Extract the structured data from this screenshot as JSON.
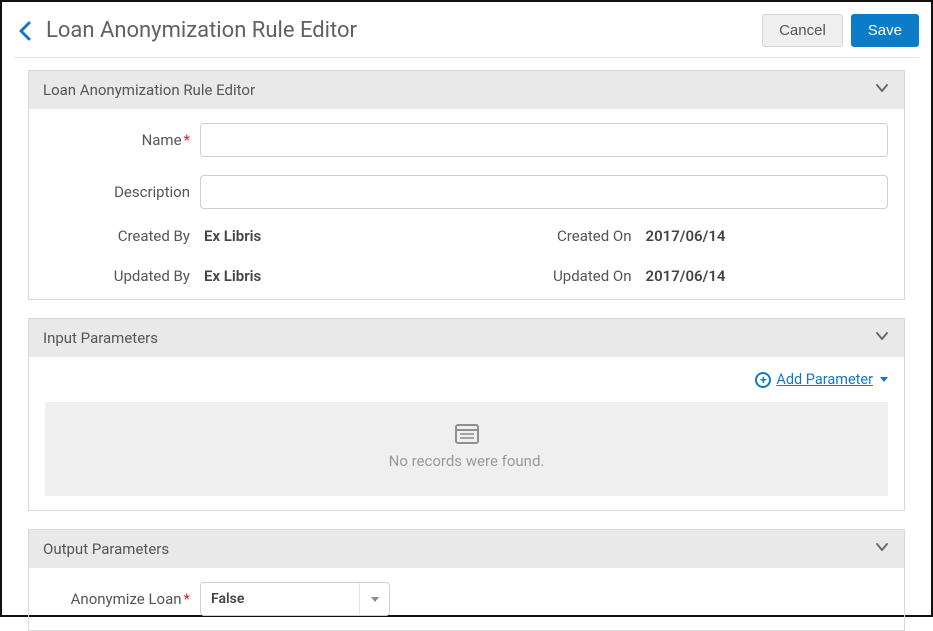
{
  "header": {
    "title": "Loan Anonymization Rule Editor",
    "cancel_label": "Cancel",
    "save_label": "Save"
  },
  "panels": {
    "editor": {
      "title": "Loan Anonymization Rule Editor",
      "name_label": "Name",
      "description_label": "Description",
      "name_value": "",
      "description_value": "",
      "created_by_label": "Created By",
      "created_by_value": "Ex Libris",
      "created_on_label": "Created On",
      "created_on_value": "2017/06/14",
      "updated_by_label": "Updated By",
      "updated_by_value": "Ex Libris",
      "updated_on_label": "Updated On",
      "updated_on_value": "2017/06/14"
    },
    "input_params": {
      "title": "Input Parameters",
      "add_label": "Add Parameter",
      "empty_message": "No records were found."
    },
    "output_params": {
      "title": "Output Parameters",
      "anonymize_label": "Anonymize Loan",
      "anonymize_value": "False"
    }
  }
}
